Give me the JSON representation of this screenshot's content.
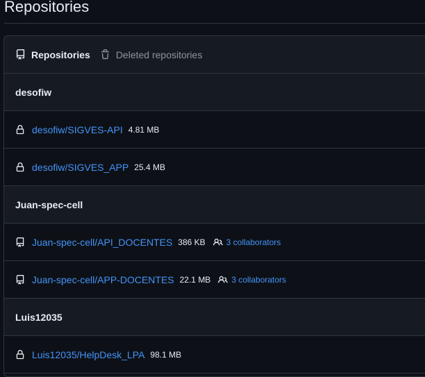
{
  "page": {
    "title": "Repositories"
  },
  "tabs": [
    {
      "label": "Repositories",
      "icon": "repo-icon",
      "active": true
    },
    {
      "label": "Deleted repositories",
      "icon": "trash-icon",
      "active": false
    }
  ],
  "groups": [
    {
      "name": "desofiw",
      "repos": [
        {
          "name": "desofiw/SIGVES-API",
          "size": "4.81 MB",
          "icon": "lock-icon"
        },
        {
          "name": "desofiw/SIGVES_APP",
          "size": "25.4 MB",
          "icon": "lock-icon"
        }
      ]
    },
    {
      "name": "Juan-spec-cell",
      "repos": [
        {
          "name": "Juan-spec-cell/API_DOCENTES",
          "size": "386 KB",
          "icon": "repo-icon",
          "collaborators": "3 collaborators"
        },
        {
          "name": "Juan-spec-cell/APP-DOCENTES",
          "size": "22.1 MB",
          "icon": "repo-icon",
          "collaborators": "3 collaborators"
        }
      ]
    },
    {
      "name": "Luis12035",
      "repos": [
        {
          "name": "Luis12035/HelpDesk_LPA",
          "size": "98.1 MB",
          "icon": "lock-icon"
        }
      ]
    }
  ],
  "colors": {
    "background": "#0d1117",
    "panel": "#161b22",
    "border": "#30363d",
    "link": "#4493f8",
    "muted": "#8b949e"
  }
}
